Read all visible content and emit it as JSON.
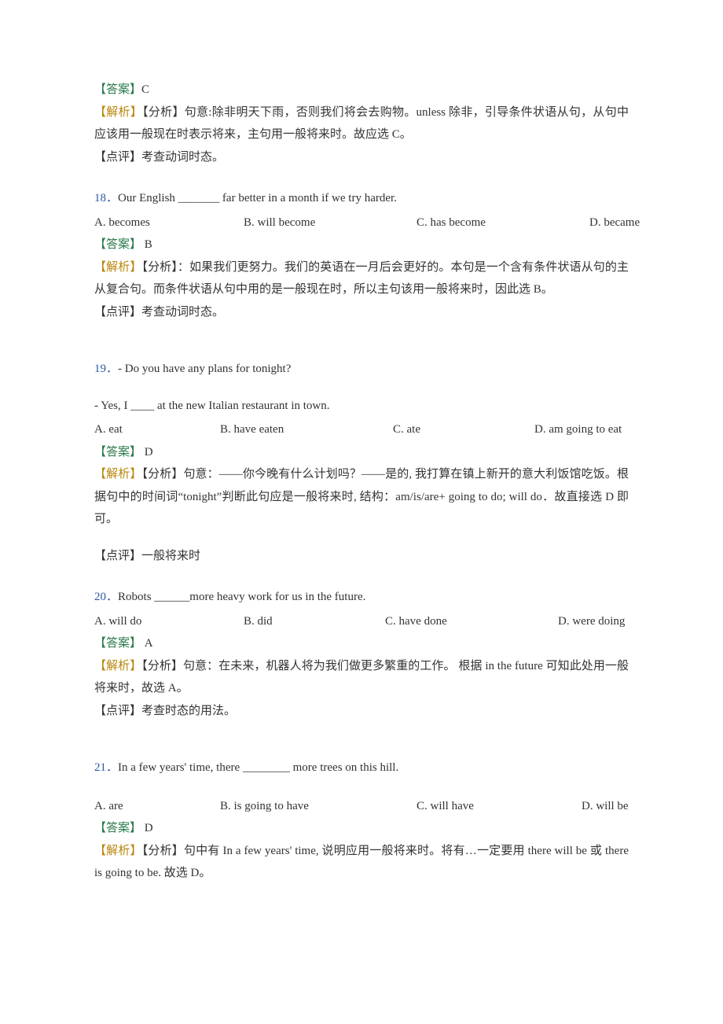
{
  "labels": {
    "answer": "【答案】",
    "explanation": "【解析】",
    "analysis": "【分析】",
    "comment": "【点评】"
  },
  "q17_tail": {
    "answer": "C",
    "exp": "句意:除非明天下雨，否则我们将会去购物。unless 除非，引导条件状语从句，从句中应该用一般现在时表示将来，主句用一般将来时。故应选 C。",
    "comment": "考查动词时态。"
  },
  "q18": {
    "num": "18．",
    "text": "Our English _______ far better in a month if we try harder.",
    "choices": {
      "a": "A. becomes",
      "b": "B. will become",
      "c": "C. has become",
      "d": "D. became"
    },
    "answer": " B",
    "exp": "：如果我们更努力。我们的英语在一月后会更好的。本句是一个含有条件状语从句的主从复合句。而条件状语从句中用的是一般现在时，所以主句该用一般将来时，因此选 B。",
    "comment": "考查动词时态。"
  },
  "q19": {
    "num": "19．",
    "text": "- Do you have any plans for tonight?",
    "line2": "- Yes, I ____ at the new Italian restaurant in town.",
    "choices": {
      "a": "A. eat",
      "b": "B. have eaten",
      "c": "C. ate",
      "d": "D. am going to eat"
    },
    "answer": " D",
    "exp": "句意：——你今晚有什么计划吗？——是的, 我打算在镇上新开的意大利饭馆吃饭。根据句中的时间词“tonight”判断此句应是一般将来时, 结构：am/is/are+ going to do;   will do．故直接选 D 即可。",
    "comment": "一般将来时"
  },
  "q20": {
    "num": "20．",
    "text": "Robots ______more heavy work for us in the future.",
    "choices": {
      "a": "A. will do",
      "b": "B. did",
      "c": "C. have done",
      "d": "D. were doing"
    },
    "answer": " A",
    "exp": "句意：在未来，机器人将为我们做更多繁重的工作。 根据 in the future 可知此处用一般将来时，故选 A。",
    "comment": "考查时态的用法。"
  },
  "q21": {
    "num": "21．",
    "text": "In a few years' time, there ________ more trees on this hill.",
    "choices": {
      "a": "A. are",
      "b": "B. is going to have",
      "c": "C. will have",
      "d": "D. will be"
    },
    "answer": " D",
    "exp": "句中有 In a few years' time, 说明应用一般将来时。将有…一定要用 there will be 或 there is going to be. 故选 D。"
  }
}
